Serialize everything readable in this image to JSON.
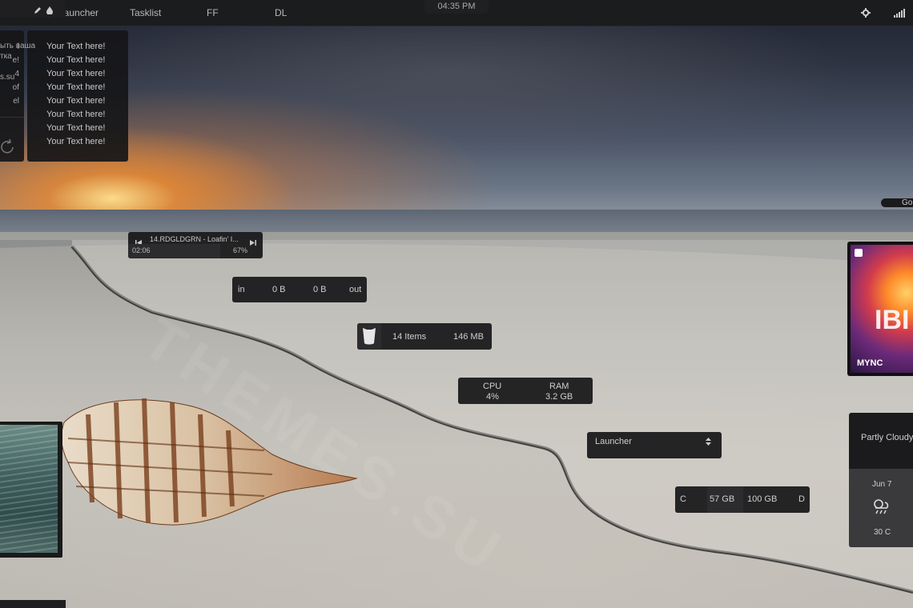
{
  "topbar": {
    "links": [
      "Launcher",
      "Tasklist",
      "FF",
      "DL"
    ],
    "clock": "04:35 PM",
    "icons": [
      "gear-icon",
      "signal-icon"
    ]
  },
  "text_widget": {
    "lines": [
      "Your Text here!",
      "Your Text here!",
      "Your Text here!",
      "Your Text here!",
      "Your Text here!",
      "Your Text here!",
      "Your Text here!",
      "Your Text here!"
    ]
  },
  "left_partial": {
    "marks": [
      "l",
      "e!",
      "4",
      "of",
      "el"
    ]
  },
  "media": {
    "track": "14.RDGLDGRN - Loafin' I...",
    "time": "02:06",
    "progress": "67%"
  },
  "network": {
    "in_label": "in",
    "in_value": "0 B",
    "out_value": "0 B",
    "out_label": "out"
  },
  "recycle": {
    "items": "14 Items",
    "size": "146 MB"
  },
  "system": {
    "cpu_label": "CPU",
    "cpu_value": "4%",
    "ram_label": "RAM",
    "ram_value": "3.2 GB"
  },
  "launcher_widget": {
    "label": "Launcher"
  },
  "disk": {
    "drive": "C",
    "used": "57 GB",
    "total": "100 GB",
    "drive2": "D"
  },
  "note": {
    "lines": [
      "ыть ваша",
      "тка",
      "s.su"
    ]
  },
  "google_bar": {
    "label": "Go"
  },
  "album": {
    "title": "IBI",
    "brand": "MYNC"
  },
  "weather": {
    "condition": "Partly Cloudy",
    "date": "Jun 7",
    "temp": "30 C"
  },
  "watermark": "THEMES.SU"
}
